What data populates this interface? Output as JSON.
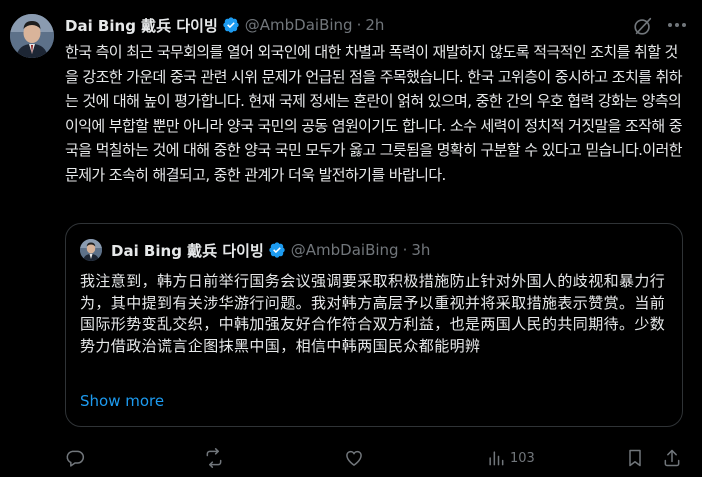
{
  "tweet": {
    "author_name": "Dai Bing 戴兵 다이빙",
    "handle": "@AmbDaiBing",
    "separator": "·",
    "time": "2h",
    "body": "한국 측이 최근 국무회의를 열어 외국인에 대한 차별과 폭력이 재발하지 않도록 적극적인 조치를 취할 것을 강조한 가운데 중국 관련 시위 문제가 언급된 점을 주목했습니다. 한국 고위층이 중시하고 조치를 취하는 것에 대해 높이 평가합니다. 현재 국제 정세는 혼란이 얽혀 있으며, 중한 간의 우호 협력 강화는 양측의 이익에 부합할 뿐만 아니라 양국 국민의 공동 염원이기도 합니다. 소수 세력이 정치적 거짓말을 조작해 중국을 먹칠하는 것에 대해 중한 양국 국민 모두가 옳고 그릇됨을 명확히 구분할 수 있다고 믿습니다.이러한 문제가 조속히 해결되고, 중한 관계가 더욱 발전하기를 바랍니다."
  },
  "quote": {
    "author_name": "Dai Bing 戴兵 다이빙",
    "handle": "@AmbDaiBing",
    "separator": "·",
    "time": "3h",
    "body": "我注意到，韩方日前举行国务会议强调要采取积极措施防止针对外国人的歧视和暴力行为，其中提到有关涉华游行问题。我对韩方高层予以重视并将采取措施表示赞赏。当前国际形势变乱交织，中韩加强友好合作符合双方利益，也是两国人民的共同期待。少数势力借政治谎言企图抹黑中国，相信中韩两国民众都能明辨",
    "show_more": "Show more"
  },
  "actions": {
    "reply": "",
    "retweet": "",
    "like": "",
    "views": "103"
  },
  "colors": {
    "background": "#000000",
    "text": "#e7e9ea",
    "muted": "#71767b",
    "accent": "#1d9bf0",
    "border": "#2f3336"
  },
  "icons": [
    "verified-badge-icon",
    "grok-icon",
    "more-icon",
    "reply-icon",
    "retweet-icon",
    "like-icon",
    "views-icon",
    "bookmark-icon",
    "share-icon"
  ]
}
